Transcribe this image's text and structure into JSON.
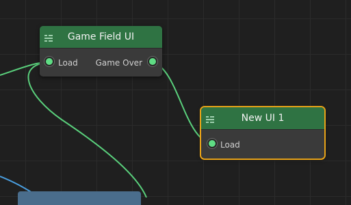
{
  "nodes": {
    "game_field": {
      "title": "Game Field UI",
      "input_label": "Load",
      "output_label": "Game Over",
      "header_icon": "list-icon"
    },
    "new_ui": {
      "title": "New UI 1",
      "input_label": "Load",
      "header_icon": "list-icon",
      "selected": true
    }
  },
  "colors": {
    "canvas_bg": "#1f1f1f",
    "grid_line": "#2b2b2b",
    "node_header": "#2f7343",
    "node_body": "#3a3a3a",
    "port": "#5fdc84",
    "connection_green": "#5ad07c",
    "connection_blue": "#4a9fe0",
    "selection_outline": "#e8a318",
    "bottom_node": "#4a6d8c"
  }
}
